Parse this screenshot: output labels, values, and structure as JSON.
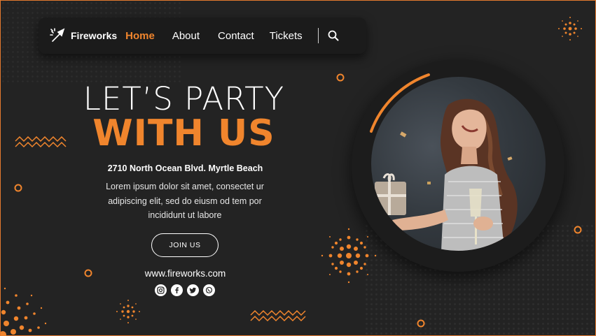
{
  "nav": {
    "brand": "Fireworks",
    "items": [
      {
        "label": "Home",
        "active": true
      },
      {
        "label": "About"
      },
      {
        "label": "Contact"
      },
      {
        "label": "Tickets"
      }
    ]
  },
  "hero": {
    "line1": "LET’S PARTY",
    "line2": "WITH US",
    "address": "2710 North Ocean Blvd. Myrtle Beach",
    "description": "Lorem ipsum dolor sit amet, consectet ur adipiscing elit, sed do eiusm od tem por incididunt ut labore",
    "cta": "JOIN US",
    "website": "www.fireworks.com"
  },
  "socials": [
    "instagram-icon",
    "facebook-icon",
    "twitter-icon",
    "whatsapp-icon"
  ],
  "colors": {
    "accent": "#f0852d",
    "background": "#232323",
    "nav_bg": "#1b1b1b",
    "text": "#ffffff"
  }
}
